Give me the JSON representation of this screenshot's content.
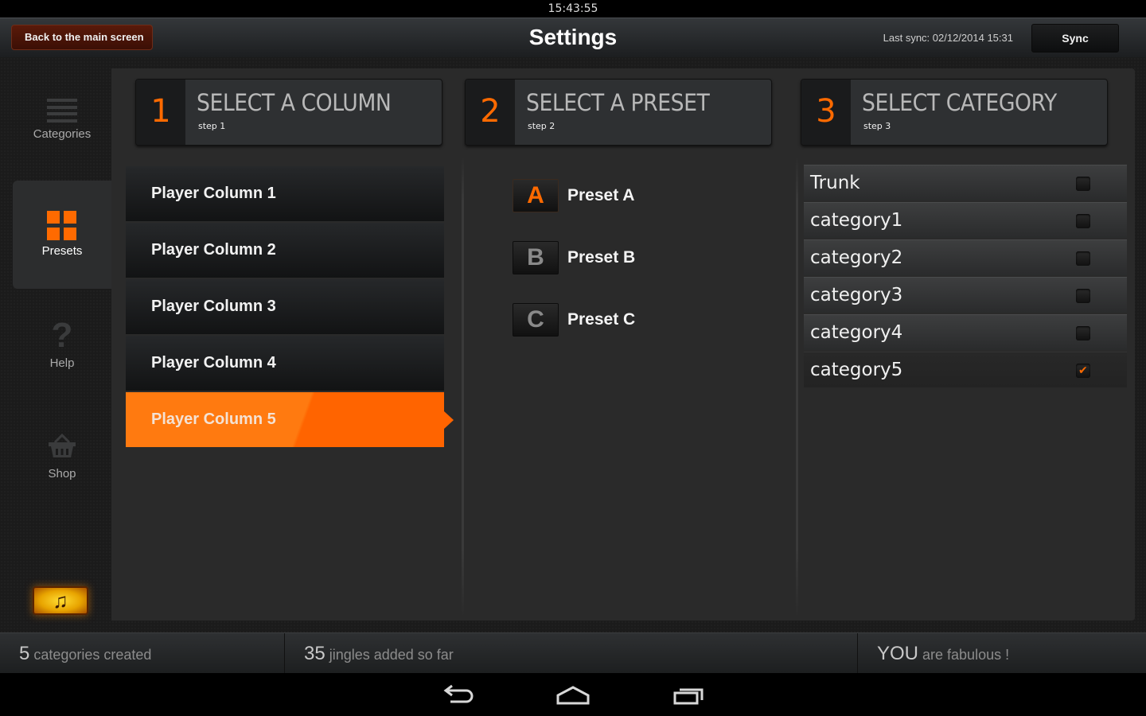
{
  "status_bar": {
    "time": "15:43:55"
  },
  "header": {
    "back_label": "Back to the main screen",
    "title": "Settings",
    "last_sync": "Last sync: 02/12/2014 15:31",
    "sync_label": "Sync"
  },
  "sidebar": {
    "items": [
      {
        "label": "Categories",
        "icon": "list-icon",
        "active": false
      },
      {
        "label": "Presets",
        "icon": "grid-icon",
        "active": true
      },
      {
        "label": "Help",
        "icon": "question-icon",
        "active": false
      },
      {
        "label": "Shop",
        "icon": "basket-icon",
        "active": false
      }
    ],
    "music_button_icon": "music-note-icon",
    "music_glyph": "♫"
  },
  "steps": [
    {
      "num": "1",
      "title": "SELECT A COLUMN",
      "sub": "step 1"
    },
    {
      "num": "2",
      "title": "SELECT A PRESET",
      "sub": "step 2"
    },
    {
      "num": "3",
      "title": "SELECT CATEGORY",
      "sub": "step 3"
    }
  ],
  "columns": [
    {
      "label": "Player Column 1",
      "selected": false
    },
    {
      "label": "Player Column 2",
      "selected": false
    },
    {
      "label": "Player Column 3",
      "selected": false
    },
    {
      "label": "Player Column 4",
      "selected": false
    },
    {
      "label": "Player Column 5",
      "selected": true
    }
  ],
  "presets": [
    {
      "key": "A",
      "label": "Preset A",
      "active": true
    },
    {
      "key": "B",
      "label": "Preset B",
      "active": false
    },
    {
      "key": "C",
      "label": "Preset C",
      "active": false
    }
  ],
  "categories": [
    {
      "label": "Trunk",
      "checked": false
    },
    {
      "label": "category1",
      "checked": false
    },
    {
      "label": "category2",
      "checked": false
    },
    {
      "label": "category3",
      "checked": false
    },
    {
      "label": "category4",
      "checked": false
    },
    {
      "label": "category5",
      "checked": true
    }
  ],
  "checkmark": "✔",
  "footer": {
    "stats": [
      {
        "value": "5",
        "text": "categories created"
      },
      {
        "value": "35",
        "text": "jingles added so far"
      },
      {
        "value": "YOU",
        "text": "are fabulous !"
      }
    ]
  },
  "colors": {
    "accent": "#ff6a00",
    "back_button": "#4a1408",
    "panel": "#2a2a2a"
  }
}
